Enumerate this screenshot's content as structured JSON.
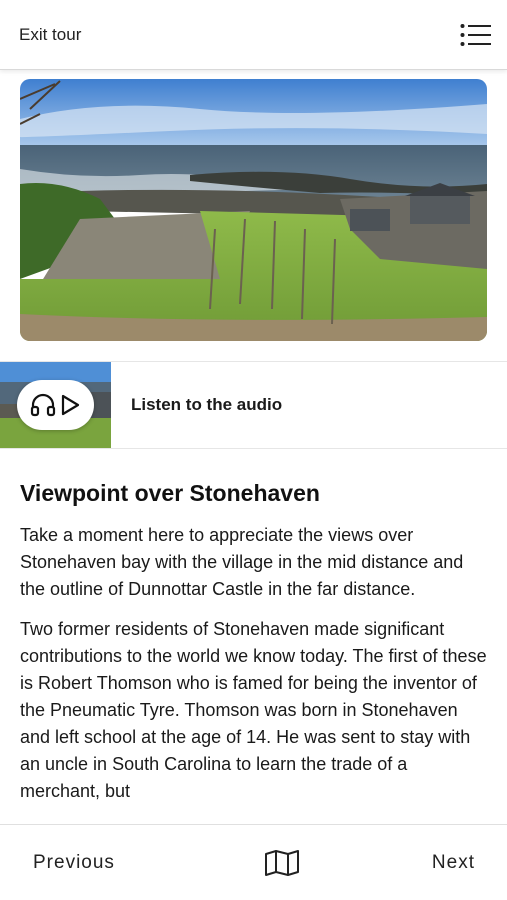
{
  "header": {
    "exit_label": "Exit tour",
    "menu_icon": "menu-icon"
  },
  "hero": {
    "image_subject": "coastal-landscape-photo"
  },
  "audio": {
    "label": "Listen to the audio",
    "icons": [
      "headphones-icon",
      "play-icon"
    ]
  },
  "article": {
    "title": "Viewpoint over Stonehaven",
    "paragraphs": [
      "Take a moment here to appreciate the views over Stonehaven bay with the village in the mid distance and the outline of Dunnottar Castle in the far distance.",
      "Two former residents of Stonehaven made significant contributions to the world we know today. The first of these is Robert Thomson who is famed for being the inventor of the Pneumatic Tyre. Thomson was born in Stonehaven and left school at the age of 14. He was sent to stay with an uncle in South Carolina to learn the trade of a merchant, but"
    ]
  },
  "footer": {
    "previous_label": "Previous",
    "next_label": "Next",
    "map_icon": "map-icon"
  }
}
